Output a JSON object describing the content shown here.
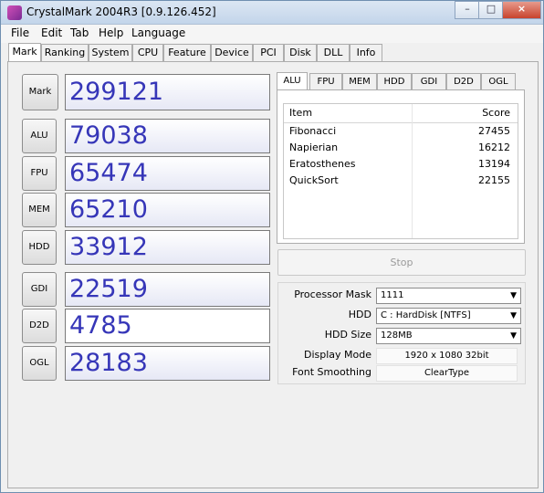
{
  "window": {
    "title": "CrystalMark 2004R3 [0.9.126.452]"
  },
  "menu": [
    "File",
    "Edit",
    "Tab",
    "Help",
    "Language"
  ],
  "tabs": [
    "Mark",
    "Ranking",
    "System",
    "CPU",
    "Feature",
    "Device",
    "PCI",
    "Disk",
    "DLL",
    "Info"
  ],
  "scores": [
    {
      "label": "Mark",
      "value": "299121"
    },
    {
      "label": "ALU",
      "value": "79038"
    },
    {
      "label": "FPU",
      "value": "65474"
    },
    {
      "label": "MEM",
      "value": "65210"
    },
    {
      "label": "HDD",
      "value": "33912"
    },
    {
      "label": "GDI",
      "value": "22519"
    },
    {
      "label": "D2D",
      "value": "4785"
    },
    {
      "label": "OGL",
      "value": "28183"
    }
  ],
  "sub_tabs": [
    "ALU",
    "FPU",
    "MEM",
    "HDD",
    "GDI",
    "D2D",
    "OGL"
  ],
  "table": {
    "headers": [
      "Item",
      "Score"
    ],
    "rows": [
      {
        "item": "Fibonacci",
        "score": "27455"
      },
      {
        "item": "Napierian",
        "score": "16212"
      },
      {
        "item": "Eratosthenes",
        "score": "13194"
      },
      {
        "item": "QuickSort",
        "score": "22155"
      }
    ]
  },
  "stop_label": "Stop",
  "settings": {
    "processor_mask": {
      "label": "Processor Mask",
      "value": "1111"
    },
    "hdd": {
      "label": "HDD",
      "value": "C : HardDisk [NTFS]"
    },
    "hdd_size": {
      "label": "HDD Size",
      "value": "128MB"
    },
    "display_mode": {
      "label": "Display Mode",
      "value": "1920 x 1080 32bit"
    },
    "font_smoothing": {
      "label": "Font Smoothing",
      "value": "ClearType"
    }
  },
  "colors": {
    "score_text": "#3636b8",
    "close_button": "#c8432d"
  }
}
